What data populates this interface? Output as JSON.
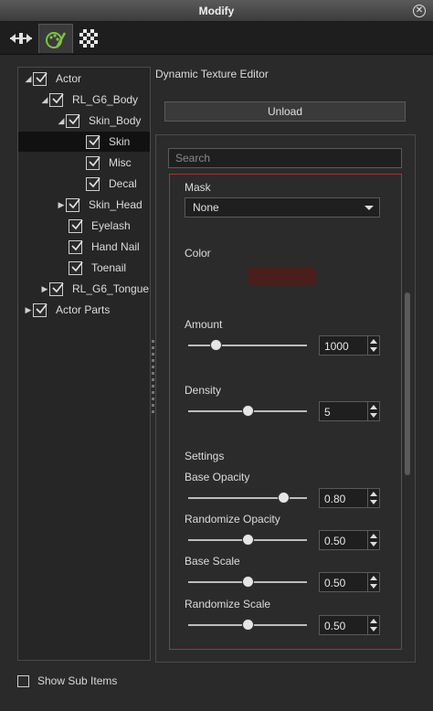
{
  "window": {
    "title": "Modify"
  },
  "tabs": [
    {
      "name": "transform",
      "icon": "transform-icon"
    },
    {
      "name": "material",
      "icon": "material-icon",
      "active": true
    },
    {
      "name": "texture",
      "icon": "checker-icon"
    }
  ],
  "tree": {
    "items": [
      {
        "label": "Actor",
        "expanded": true
      },
      {
        "label": "RL_G6_Body",
        "expanded": true
      },
      {
        "label": "Skin_Body",
        "expanded": true
      },
      {
        "label": "Skin",
        "selected": true
      },
      {
        "label": "Misc"
      },
      {
        "label": "Decal"
      },
      {
        "label": "Skin_Head",
        "collapsed": true
      },
      {
        "label": "Eyelash"
      },
      {
        "label": "Hand Nail"
      },
      {
        "label": "Toenail"
      },
      {
        "label": "RL_G6_Tongue",
        "collapsed": true
      },
      {
        "label": "Actor Parts",
        "collapsed": true
      }
    ]
  },
  "editor": {
    "title": "Dynamic Texture Editor",
    "unload_label": "Unload",
    "search_placeholder": "Search",
    "mask_label": "Mask",
    "mask_value": "None",
    "color_label": "Color",
    "color_value": "#4a1e1a",
    "amount_label": "Amount",
    "amount_value": "1000",
    "amount_level": 0.23,
    "density_label": "Density",
    "density_value": "5",
    "density_level": 0.5,
    "settings_label": "Settings",
    "base_opacity_label": "Base Opacity",
    "base_opacity_value": "0.80",
    "base_opacity_level": 0.8,
    "rand_opacity_label": "Randomize Opacity",
    "rand_opacity_value": "0.50",
    "rand_opacity_level": 0.5,
    "base_scale_label": "Base Scale",
    "base_scale_value": "0.50",
    "base_scale_level": 0.5,
    "rand_scale_label": "Randomize Scale",
    "rand_scale_value": "0.50",
    "rand_scale_level": 0.5
  },
  "footer": {
    "show_sub_items_label": "Show Sub Items"
  },
  "colors": {
    "highlight_border": "#c0272d"
  }
}
